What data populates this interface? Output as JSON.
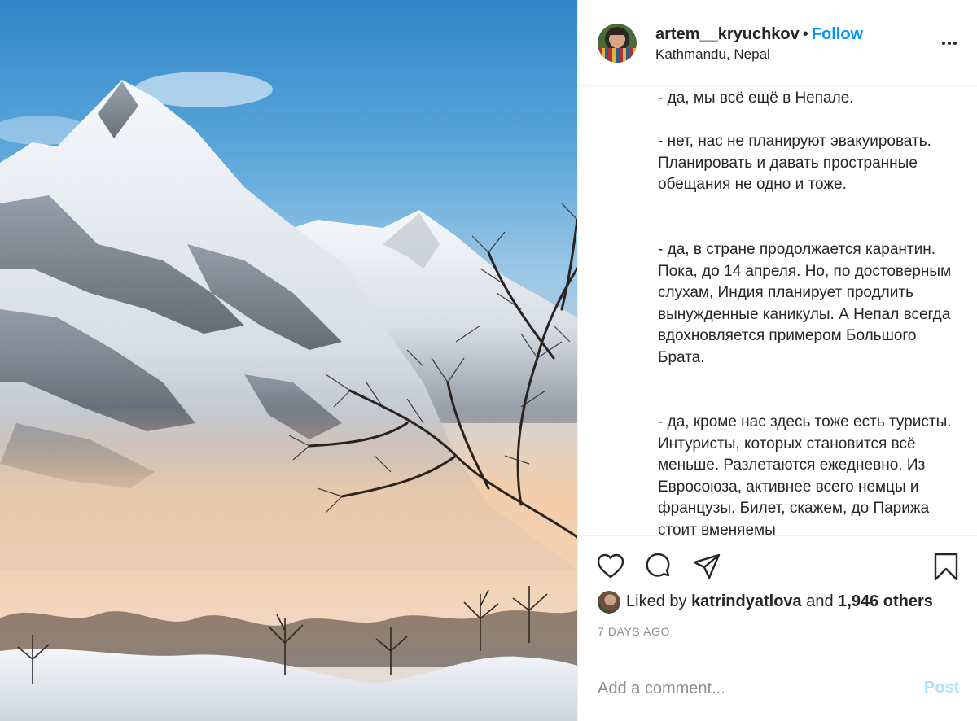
{
  "post": {
    "username": "artem__kryuchkov",
    "separator": "•",
    "follow_label": "Follow",
    "location": "Kathmandu, Nepal",
    "more_icon": "more-horizontal-icon"
  },
  "caption": {
    "paragraphs": [
      "- да, мы всё ещё в Непале.",
      "- нет, нас не планируют эвакуировать. Планировать и давать пространные обещания не одно и тоже.",
      "- да, в стране продолжается карантин. Пока, до 14 апреля. Но, по достоверным слухам, Индия планирует продлить вынужденные каникулы. А Непал всегда вдохновляется примером Большого Брата.",
      "- да, кроме нас здесь тоже есть туристы. Интуристы, которых становится всё меньше. Разлетаются ежедневно. Из Евросоюза, активнее всего немцы и французы. Билет, скажем, до Парижа стоит вменяемы"
    ]
  },
  "actions": {
    "like_icon": "heart-icon",
    "comment_icon": "comment-icon",
    "share_icon": "send-icon",
    "save_icon": "bookmark-icon"
  },
  "likes": {
    "prefix": "Liked by",
    "liker": "katrindyatlova",
    "conjunction": "and",
    "others": "1,946 others"
  },
  "timestamp": "7 DAYS AGO",
  "comment": {
    "placeholder": "Add a comment...",
    "post_label": "Post"
  },
  "colors": {
    "accent": "#0095f6",
    "post_disabled": "#b2dffc",
    "muted": "#8e8e8e",
    "text": "#262626"
  }
}
